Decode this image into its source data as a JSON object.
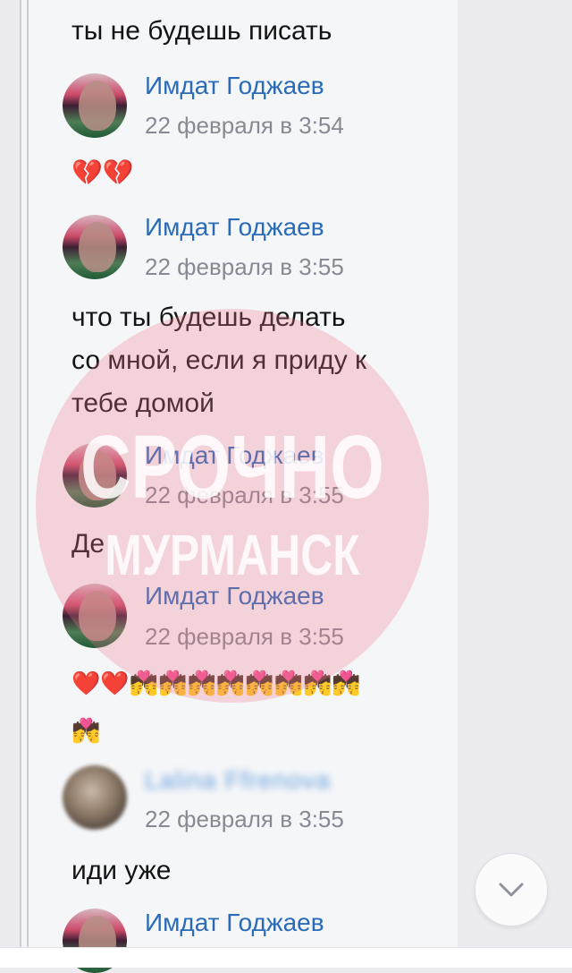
{
  "messages": [
    {
      "text": "ты не будешь писать"
    },
    {
      "author": "Имдат Годжаев",
      "time": "22 февраля в 3:54",
      "content": "💔💔"
    },
    {
      "author": "Имдат Годжаев",
      "time": "22 февраля в 3:55",
      "lines": [
        "что ты будешь делать",
        "со мной, если я приду к",
        "тебе домой"
      ]
    },
    {
      "author": "Имдат Годжаев",
      "time": "22 февраля в 3:55",
      "content": "Де"
    },
    {
      "author": "Имдат Годжаев",
      "time": "22 февраля в 3:55",
      "lines": [
        "❤️❤️💏💏💏💏💏💏💏💏",
        "💏"
      ]
    },
    {
      "author": "Lalina Ffrenova",
      "time": "22 февраля в 3:55",
      "content": "иди уже"
    },
    {
      "author": "Имдат Годжаев"
    }
  ],
  "watermark": {
    "line1": "СРОЧНО",
    "line2": "МУРМАНСК"
  },
  "scroll_button": {
    "icon": "chevron-down-icon"
  },
  "colors": {
    "author": "#2a6bb8",
    "time": "#858a93",
    "panel": "#f5f6f8",
    "watermark": "#ec788c"
  }
}
